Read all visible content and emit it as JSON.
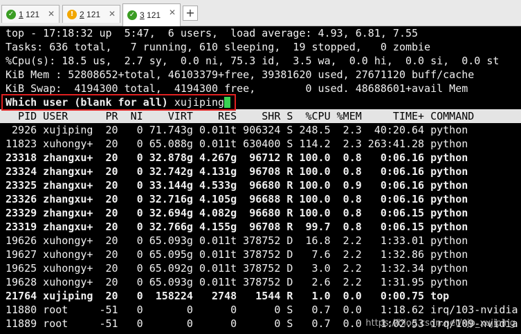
{
  "tabs": [
    {
      "num": "1",
      "title": "121",
      "status": "ok"
    },
    {
      "num": "2",
      "title": "121",
      "status": "warn"
    },
    {
      "num": "3",
      "title": "121",
      "status": "ok",
      "active": true
    }
  ],
  "add_tab_label": "+",
  "close_glyph": "✕",
  "terminal": {
    "summary": [
      "top - 17:18:32 up  5:47,  6 users,  load average: 4.93, 6.81, 7.55",
      "Tasks: 636 total,   7 running, 610 sleeping,  19 stopped,   0 zombie",
      "%Cpu(s): 18.5 us,  2.7 sy,  0.0 ni, 75.3 id,  3.5 wa,  0.0 hi,  0.0 si,  0.0 st",
      "KiB Mem : 52808652+total, 46103379+free, 39381620 used, 27671120 buff/cache",
      "KiB Swap:  4194300 total,  4194300 free,        0 used. 48688601+avail Mem"
    ],
    "prompt": "Which user (blank for all) ",
    "prompt_input": "xujiping",
    "header": "  PID USER      PR  NI    VIRT    RES    SHR S  %CPU %MEM     TIME+ COMMAND",
    "processes": [
      {
        "line": " 2926 xujiping  20   0 71.743g 0.011t 906324 S 248.5  2.3  40:20.64 python",
        "bold": false
      },
      {
        "line": "11823 xuhongy+  20   0 65.088g 0.011t 630400 S 114.2  2.3 263:41.28 python",
        "bold": false
      },
      {
        "line": "23318 zhangxu+  20   0 32.878g 4.267g  96712 R 100.0  0.8   0:06.16 python",
        "bold": true
      },
      {
        "line": "23324 zhangxu+  20   0 32.742g 4.131g  96708 R 100.0  0.8   0:06.16 python",
        "bold": true
      },
      {
        "line": "23325 zhangxu+  20   0 33.144g 4.533g  96680 R 100.0  0.9   0:06.16 python",
        "bold": true
      },
      {
        "line": "23326 zhangxu+  20   0 32.716g 4.105g  96688 R 100.0  0.8   0:06.16 python",
        "bold": true
      },
      {
        "line": "23329 zhangxu+  20   0 32.694g 4.082g  96680 R 100.0  0.8   0:06.15 python",
        "bold": true
      },
      {
        "line": "23319 zhangxu+  20   0 32.766g 4.155g  96708 R  99.7  0.8   0:06.15 python",
        "bold": true
      },
      {
        "line": "19626 xuhongy+  20   0 65.093g 0.011t 378752 D  16.8  2.2   1:33.01 python",
        "bold": false
      },
      {
        "line": "19627 xuhongy+  20   0 65.095g 0.011t 378752 D   7.6  2.2   1:32.86 python",
        "bold": false
      },
      {
        "line": "19625 xuhongy+  20   0 65.092g 0.011t 378752 D   3.0  2.2   1:32.34 python",
        "bold": false
      },
      {
        "line": "19628 xuhongy+  20   0 65.093g 0.011t 378752 D   2.6  2.2   1:31.95 python",
        "bold": false
      },
      {
        "line": "21764 xujiping  20   0  158224   2748   1544 R   1.0  0.0   0:00.75 top",
        "bold": true
      },
      {
        "line": "11880 root     -51   0       0      0      0 S   0.7  0.0   1:18.62 irq/103-nvidia",
        "bold": false
      },
      {
        "line": "11889 root     -51   0       0      0      0 S   0.7  0.0   1:02.53 irq/109-nvidia",
        "bold": false
      }
    ]
  },
  "watermark": "https://blog.csdn.net/xjp_xujiping",
  "colors": {
    "terminal_bg": "#000000",
    "terminal_fg": "#f0f0f0",
    "cursor": "#39d353",
    "highlight_box": "#e02020",
    "header_bg": "#e4e4e4"
  }
}
